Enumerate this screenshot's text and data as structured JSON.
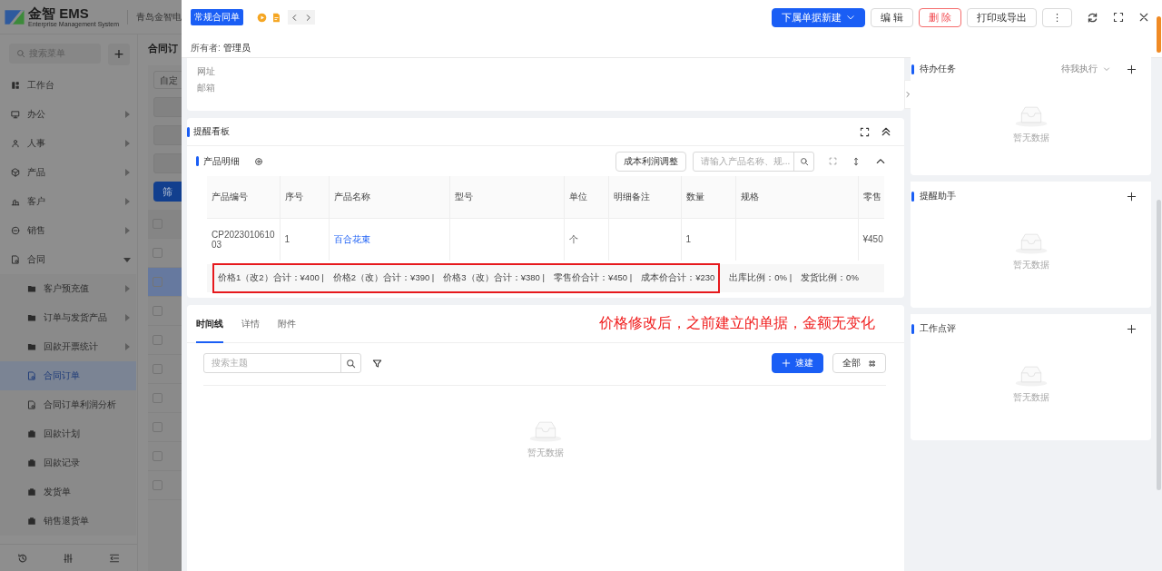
{
  "app": {
    "logo_text": "金智 EMS",
    "logo_subtitle": "Enterprise Management System",
    "company": "青岛金智电"
  },
  "sidebar": {
    "search_placeholder": "搜索菜单",
    "add_button": "+",
    "items": [
      {
        "label": "工作台",
        "kind": "page",
        "selected": false
      },
      {
        "label": "办公",
        "kind": "group",
        "expanded": false,
        "selected": false
      },
      {
        "label": "人事",
        "kind": "group",
        "expanded": false,
        "selected": false
      },
      {
        "label": "产品",
        "kind": "group",
        "expanded": false,
        "selected": false
      },
      {
        "label": "客户",
        "kind": "group",
        "expanded": false,
        "selected": false
      },
      {
        "label": "销售",
        "kind": "group",
        "expanded": false,
        "selected": false
      },
      {
        "label": "合同",
        "kind": "group",
        "expanded": true,
        "selected": false,
        "children": [
          {
            "label": "客户预充值",
            "kind": "group",
            "expanded": false,
            "selected": false
          },
          {
            "label": "订单与发货产品",
            "kind": "group",
            "expanded": false,
            "selected": false
          },
          {
            "label": "回款开票统计",
            "kind": "group",
            "expanded": false,
            "selected": false
          },
          {
            "label": "合同订单",
            "kind": "page",
            "selected": true
          },
          {
            "label": "合同订单利润分析",
            "kind": "page",
            "selected": false
          },
          {
            "label": "回款计划",
            "kind": "page",
            "selected": false
          },
          {
            "label": "回款记录",
            "kind": "page",
            "selected": false
          },
          {
            "label": "发货单",
            "kind": "page",
            "selected": false
          },
          {
            "label": "销售退货单",
            "kind": "page",
            "selected": false
          }
        ]
      }
    ]
  },
  "list_page": {
    "title": "合同订",
    "filter_placeholder": "自定",
    "filter_button": "筛",
    "all_checked": false,
    "rows": [
      {
        "selected": false,
        "checked": false
      },
      {
        "selected": true,
        "checked": false
      },
      {
        "selected": false,
        "checked": false
      },
      {
        "selected": false,
        "checked": false
      },
      {
        "selected": false,
        "checked": false
      },
      {
        "selected": false,
        "checked": false
      },
      {
        "selected": false,
        "checked": false
      },
      {
        "selected": false,
        "checked": false
      },
      {
        "selected": false,
        "checked": false
      }
    ]
  },
  "drawer": {
    "tag": "常规合同单",
    "owner_label": "所有者:",
    "owner": "管理员",
    "buttons": [
      {
        "label": "下属单据新建",
        "kind": "primary"
      },
      {
        "label": "编 辑",
        "kind": "default"
      },
      {
        "label": "删 除",
        "kind": "danger"
      },
      {
        "label": "打印或导出",
        "kind": "default"
      },
      {
        "label": "⋮",
        "kind": "default"
      }
    ],
    "info_fields": [
      "网址",
      "邮箱"
    ],
    "board": {
      "title": "提醒看板",
      "products": {
        "title": "产品明细",
        "adjust_button": "成本利润调整",
        "search_placeholder": "请输入产品名称、规...",
        "columns": [
          "产品编号",
          "序号",
          "产品名称",
          "型号",
          "单位",
          "明细备注",
          "数量",
          "规格",
          "零售"
        ],
        "rows": [
          [
            "CP202301061003",
            "1",
            "百合花束",
            "",
            "个",
            "",
            "1",
            "",
            "¥450"
          ]
        ],
        "summary": [
          {
            "text": "价格1（改2）合计：¥400 |",
            "highlighted": true
          },
          {
            "text": "价格2（改）合计：¥390 |",
            "highlighted": true
          },
          {
            "text": "价格3（改）合计：¥380 |",
            "highlighted": true
          },
          {
            "text": "零售价合计：¥450 |",
            "highlighted": true
          },
          {
            "text": "成本价合计：¥230",
            "highlighted": true
          },
          {
            "text": "出库比例：0% |",
            "highlighted": false
          },
          {
            "text": "发货比例：0%",
            "highlighted": false
          }
        ]
      }
    },
    "activity": {
      "tabs": [
        {
          "label": "时间线",
          "selected": true
        },
        {
          "label": "详情",
          "selected": false
        },
        {
          "label": "附件",
          "selected": false
        }
      ],
      "annotation": "价格修改后，之前建立的单据，金额无变化",
      "search_placeholder": "搜索主题",
      "quick_button": "速建",
      "all_button": "全部",
      "empty_text": "暂无数据"
    },
    "side_cards": [
      {
        "title": "待办任务",
        "filter": "待我执行",
        "empty_text": "暂无数据"
      },
      {
        "title": "提醒助手",
        "empty_text": "暂无数据"
      },
      {
        "title": "工作点评",
        "empty_text": "暂无数据"
      }
    ]
  }
}
